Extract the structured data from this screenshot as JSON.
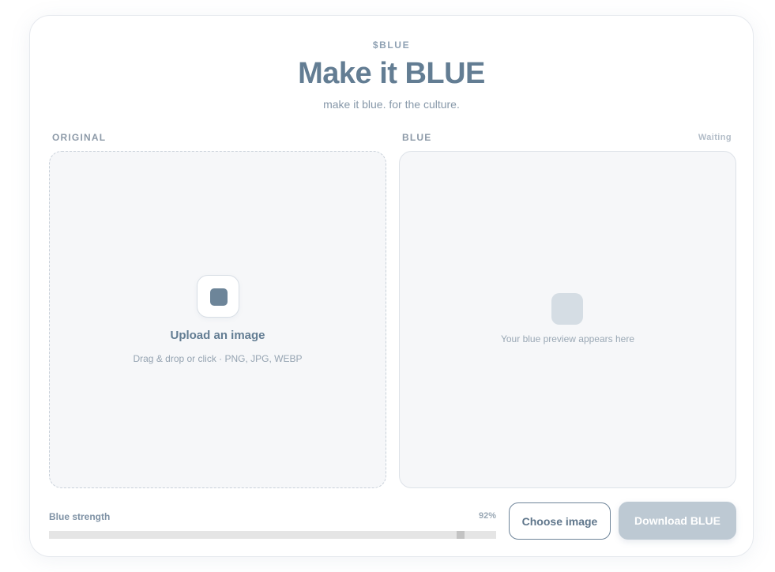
{
  "header": {
    "eyebrow": "$BLUE",
    "title": "Make it BLUE",
    "subtitle": "make it blue. for the culture."
  },
  "original_panel": {
    "label": "ORIGINAL",
    "upload_title": "Upload an image",
    "upload_hint": "Drag & drop or click · PNG, JPG, WEBP",
    "icon": "image-upload-icon"
  },
  "blue_panel": {
    "label": "BLUE",
    "status": "Waiting",
    "placeholder_text": "Your blue preview appears here",
    "icon": "preview-placeholder-icon"
  },
  "controls": {
    "strength_label": "Blue strength",
    "strength_value_text": "92%",
    "strength_value": 92,
    "choose_button": "Choose image",
    "download_button": "Download BLUE"
  },
  "colors": {
    "accent": "#637d93",
    "panel_bg": "#f6f7f9",
    "download_disabled": "#bdc9d3"
  }
}
